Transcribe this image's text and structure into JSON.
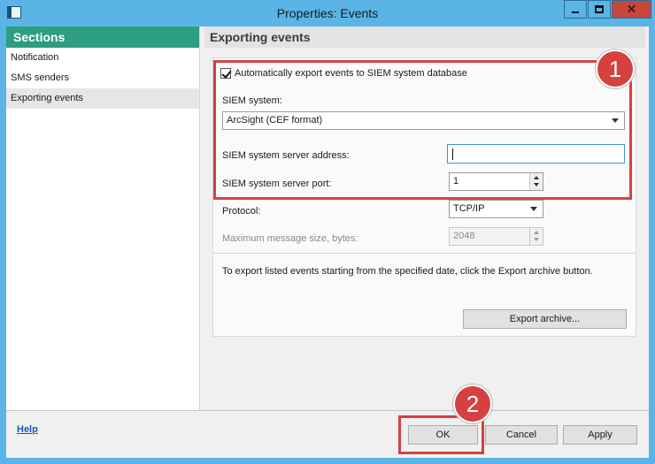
{
  "window": {
    "title": "Properties: Events",
    "controls": {
      "minimize": "minimize-icon",
      "maximize": "maximize-icon",
      "close": "✕"
    }
  },
  "sidebar": {
    "header": "Sections",
    "items": [
      {
        "label": "Notification",
        "selected": false
      },
      {
        "label": "SMS senders",
        "selected": false
      },
      {
        "label": "Exporting events",
        "selected": true
      }
    ]
  },
  "main": {
    "section_title": "Exporting events",
    "auto_export": {
      "label": "Automatically export events to SIEM system database",
      "checked": true
    },
    "siem_system": {
      "label": "SIEM system:",
      "value": "ArcSight (CEF format)"
    },
    "server_address": {
      "label": "SIEM system server address:",
      "value": ""
    },
    "server_port": {
      "label": "SIEM system server port:",
      "value": "1"
    },
    "protocol": {
      "label": "Protocol:",
      "value": "TCP/IP"
    },
    "max_message_size": {
      "label": "Maximum message size, bytes:",
      "value": "2048",
      "enabled": false
    },
    "archive_hint": "To export listed events starting from the specified date, click the Export archive button.",
    "export_archive_button": "Export archive..."
  },
  "footer": {
    "help_link": "Help",
    "ok_button": "OK",
    "cancel_button": "Cancel",
    "apply_button": "Apply"
  },
  "annotations": {
    "badge_1": "1",
    "badge_2": "2",
    "highlight_color": "#d64040"
  },
  "colors": {
    "titlebar": "#5ab4e6",
    "sidebar_header": "#2d9e80",
    "close_button": "#c7463a"
  }
}
